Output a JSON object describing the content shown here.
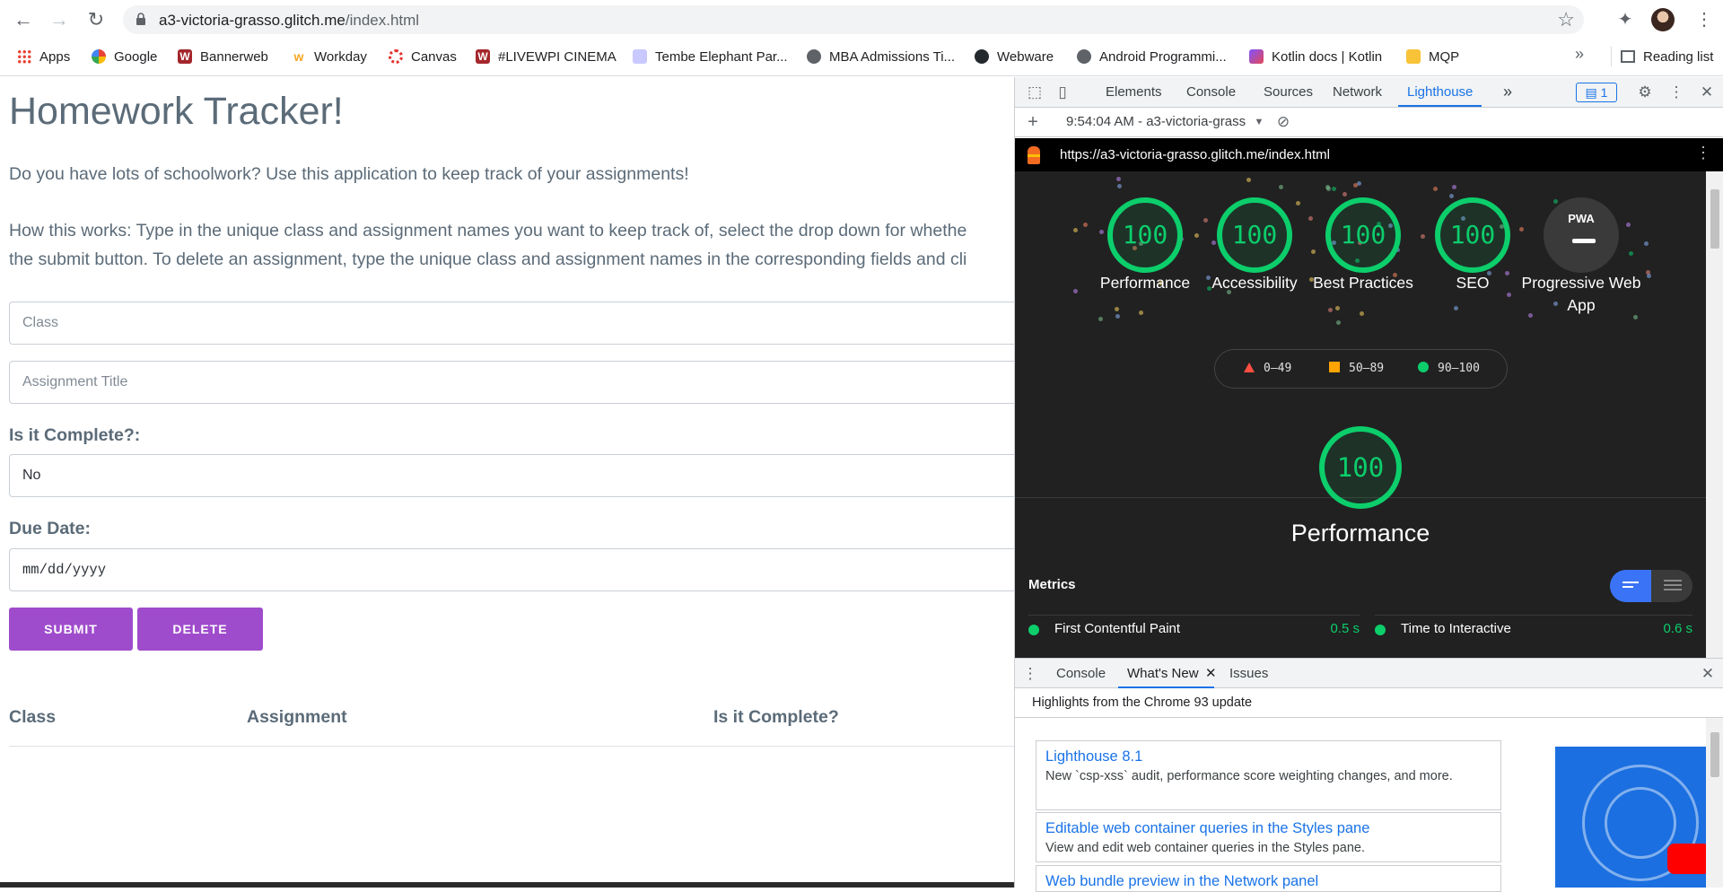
{
  "browser": {
    "url_host": "a3-victoria-grasso.glitch.me",
    "url_path": "/index.html",
    "bookmarks": [
      {
        "label": "Apps",
        "icon": "apps-grid-icon"
      },
      {
        "label": "Google",
        "icon": "google-icon"
      },
      {
        "label": "Bannerweb",
        "icon": "wpi-icon"
      },
      {
        "label": "Workday",
        "icon": "workday-icon"
      },
      {
        "label": "Canvas",
        "icon": "canvas-icon"
      },
      {
        "label": "#LIVEWPI CINEMA",
        "icon": "wpi-icon"
      },
      {
        "label": "Tembe Elephant Par...",
        "icon": "tembe-icon"
      },
      {
        "label": "MBA Admissions Ti...",
        "icon": "globe-icon"
      },
      {
        "label": "Webware",
        "icon": "github-icon"
      },
      {
        "label": "Android Programmi...",
        "icon": "globe-icon"
      },
      {
        "label": "Kotlin docs | Kotlin",
        "icon": "kotlin-icon"
      },
      {
        "label": "MQP",
        "icon": "folder-icon"
      }
    ],
    "more_bookmarks": "»",
    "reading_list": "Reading list"
  },
  "app": {
    "title": "Homework Tracker!",
    "intro": "Do you have lots of schoolwork? Use this application to keep track of your assignments!",
    "instructions_line1": "How this works: Type in the unique class and assignment names you want to keep track of, select the drop down for whethe",
    "instructions_line2": "the submit button. To delete an assignment, type the unique class and assignment names in the corresponding fields and cli",
    "class_placeholder": "Class",
    "assignment_placeholder": "Assignment Title",
    "complete_label": "Is it Complete?:",
    "complete_value": "No",
    "due_label": "Due Date:",
    "due_placeholder": "mm/dd/yyyy",
    "submit_label": "SUBMIT",
    "delete_label": "DELETE",
    "table_headers": [
      "Class",
      "Assignment",
      "Is it Complete?"
    ]
  },
  "devtools": {
    "tabs": [
      "Elements",
      "Console",
      "Sources",
      "Network",
      "Lighthouse"
    ],
    "active_tab": "Lighthouse",
    "more_tabs": "»",
    "issues_count": "1",
    "report_selector": "9:54:04 AM - a3-victoria-grass",
    "report_url": "https://a3-victoria-grasso.glitch.me/index.html",
    "scores": [
      {
        "label": "Performance",
        "score": "100"
      },
      {
        "label": "Accessibility",
        "score": "100"
      },
      {
        "label": "Best Practices",
        "score": "100"
      },
      {
        "label": "SEO",
        "score": "100"
      },
      {
        "label": "Progressive Web App",
        "score": "PWA"
      }
    ],
    "legend": [
      "0–49",
      "50–89",
      "90–100"
    ],
    "colors": {
      "pass": "#0cce6b",
      "average": "#ffa400",
      "fail": "#ff4e42"
    },
    "performance_score": "100",
    "performance_title": "Performance",
    "metrics_label": "Metrics",
    "metrics": [
      {
        "name": "First Contentful Paint",
        "value": "0.5 s"
      },
      {
        "name": "Time to Interactive",
        "value": "0.6 s"
      }
    ],
    "drawer_tabs": [
      "Console",
      "What's New",
      "Issues"
    ],
    "whats_new_header": "Highlights from the Chrome 93 update",
    "whats_new_items": [
      {
        "title": "Lighthouse 8.1",
        "desc": "New `csp-xss` audit, performance score weighting changes, and more."
      },
      {
        "title": "Editable web container queries in the Styles pane",
        "desc": "View and edit web container queries in the Styles pane."
      },
      {
        "title": "Web bundle preview in the Network panel",
        "desc": ""
      }
    ]
  }
}
